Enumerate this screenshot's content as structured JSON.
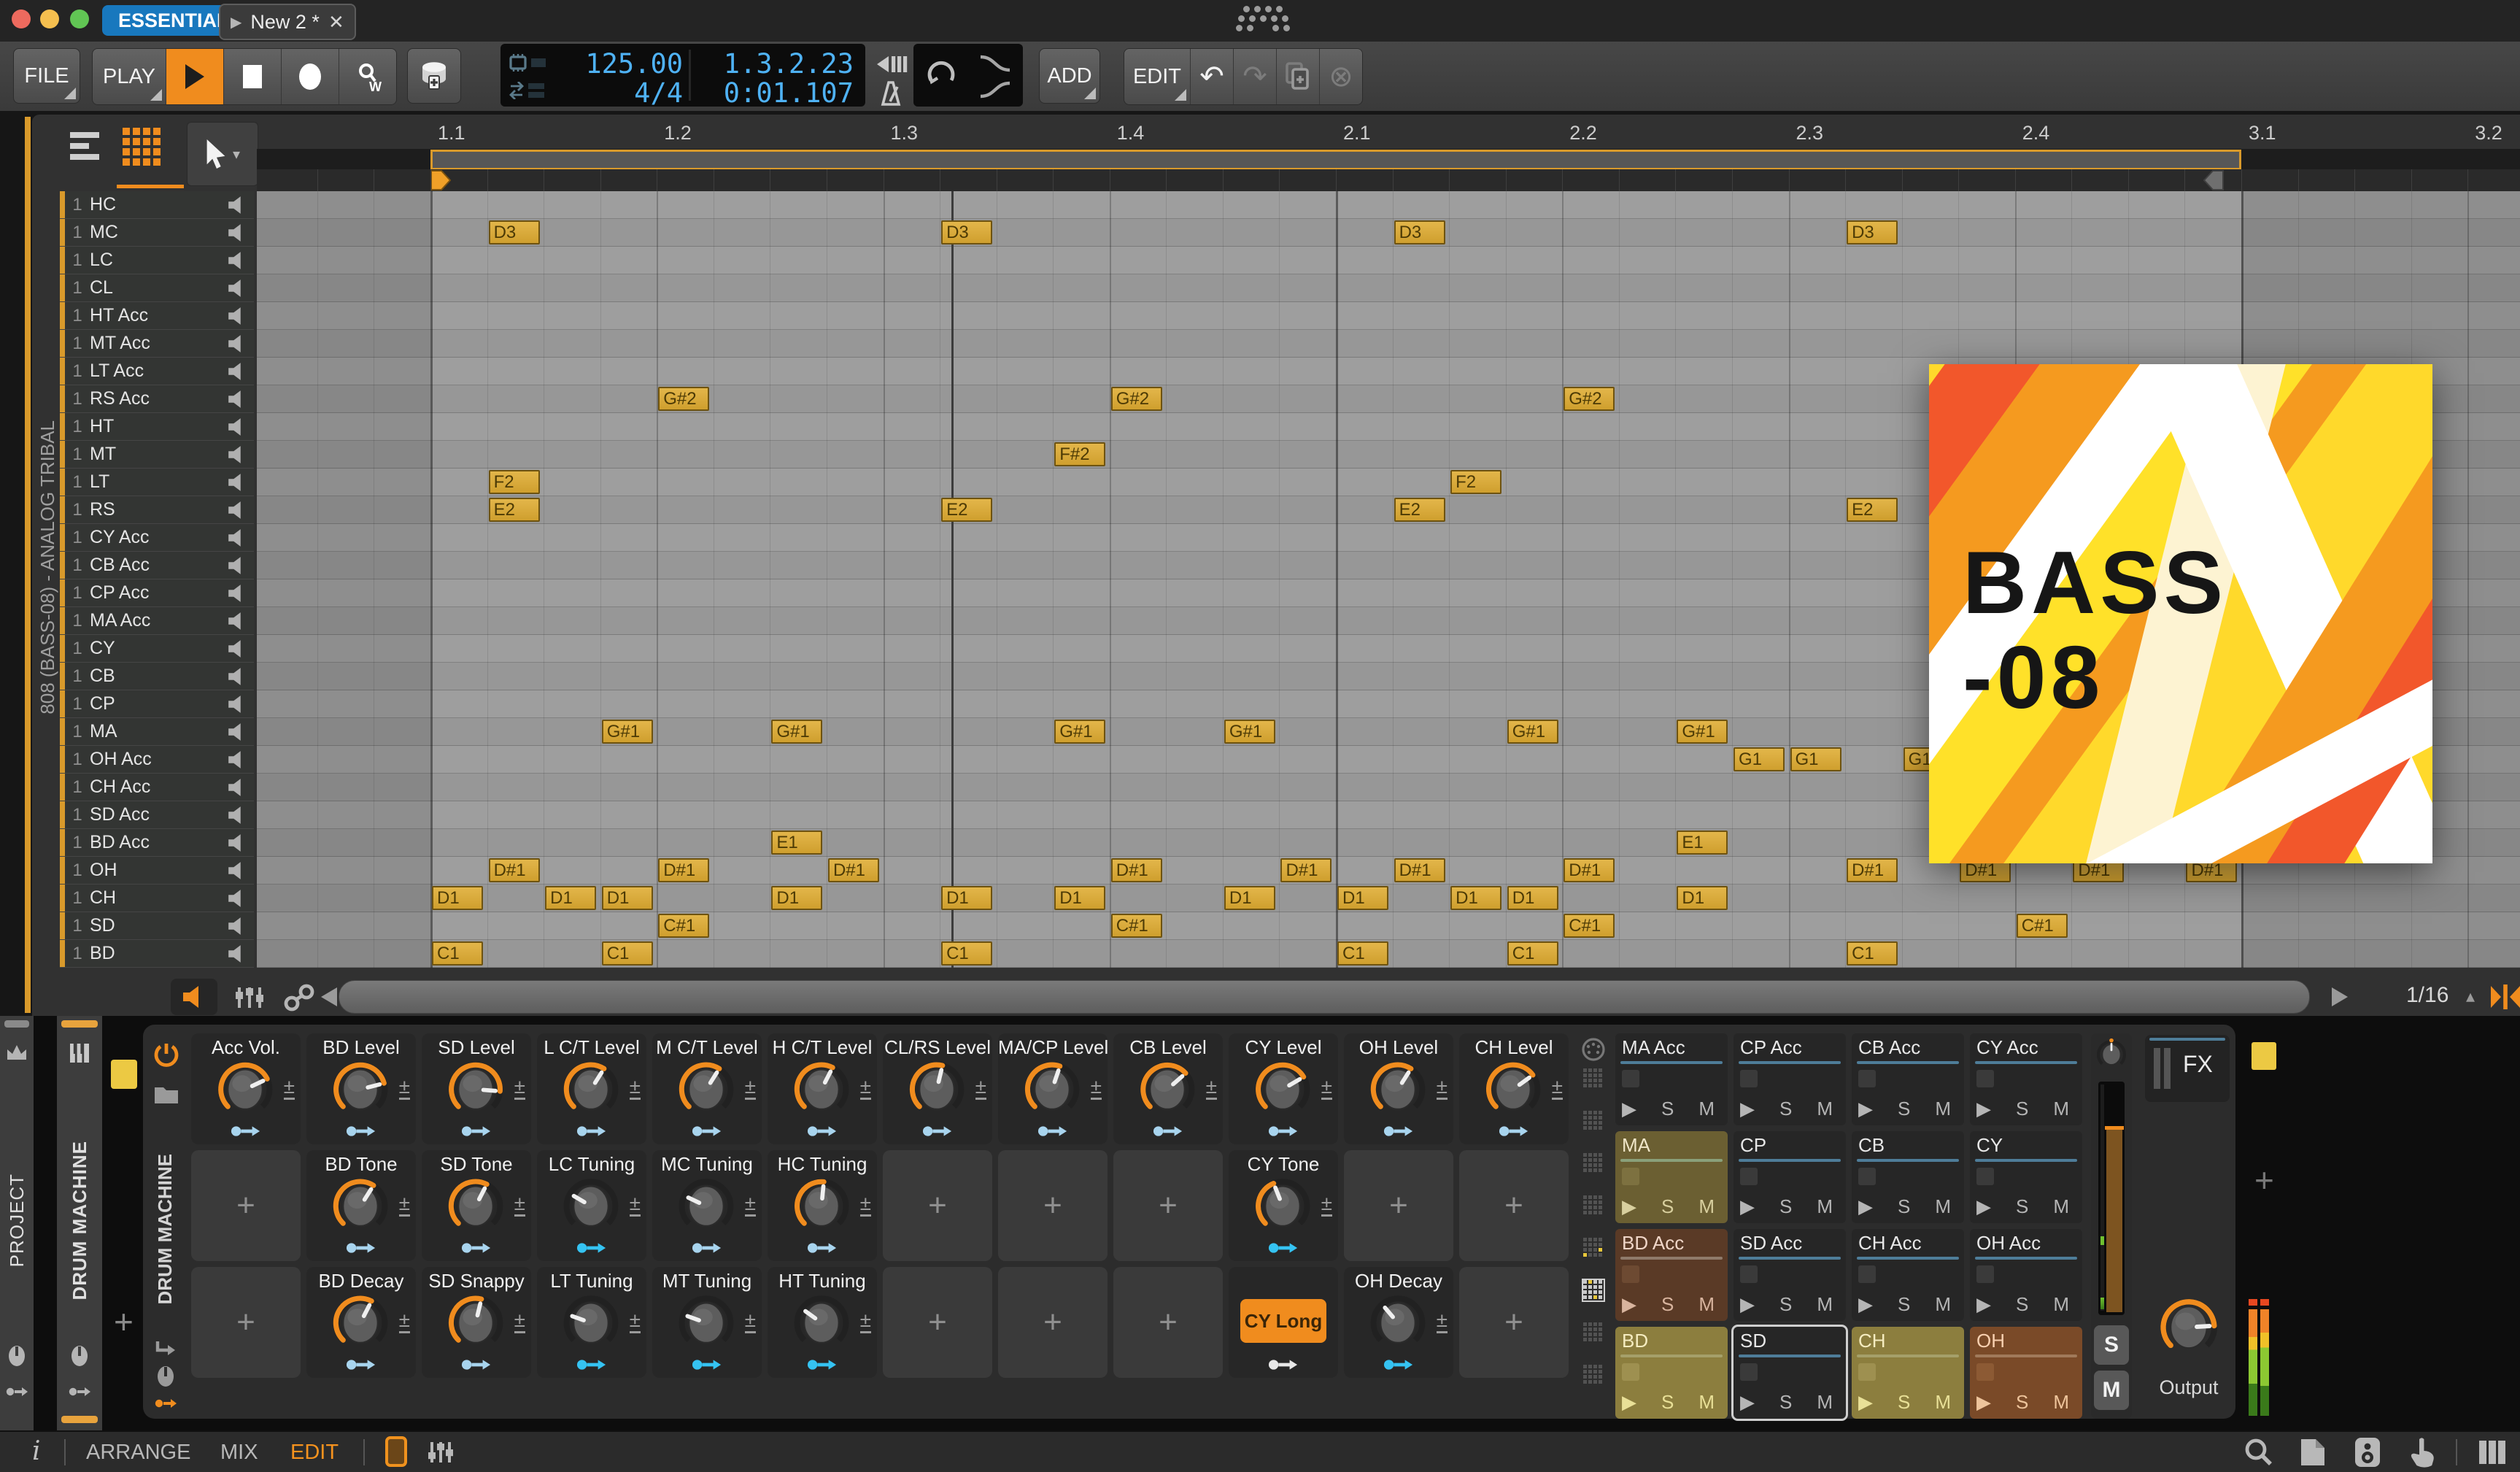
{
  "titlebar": {
    "preset_browser": "ESSENTIALS",
    "tab_play_glyph": "▶",
    "tab": "New 2 *",
    "tab_close": "✕"
  },
  "transport": {
    "file": "FILE",
    "play": "PLAY",
    "tempo": "125.00",
    "time_signature": "4/4",
    "position": "1.3.2.23",
    "time": "0:01.107",
    "add": "ADD",
    "edit": "EDIT",
    "undo_glyph": "↶",
    "redo_glyph": "↷",
    "delete_glyph": "⊗"
  },
  "editor": {
    "track_context": "808 (BASS-08) - ANALOG TRIBAL",
    "ruler_marks": [
      "1.1",
      "1.2",
      "1.3",
      "1.4",
      "2.1",
      "2.2",
      "2.3",
      "2.4",
      "3.1",
      "3.2"
    ],
    "grid_resolution": "1/16",
    "grid_res_stepper": "▴",
    "lanes": [
      {
        "n": "1",
        "name": "HC"
      },
      {
        "n": "1",
        "name": "MC"
      },
      {
        "n": "1",
        "name": "LC"
      },
      {
        "n": "1",
        "name": "CL"
      },
      {
        "n": "1",
        "name": "HT Acc"
      },
      {
        "n": "1",
        "name": "MT Acc"
      },
      {
        "n": "1",
        "name": "LT Acc"
      },
      {
        "n": "1",
        "name": "RS Acc"
      },
      {
        "n": "1",
        "name": "HT"
      },
      {
        "n": "1",
        "name": "MT"
      },
      {
        "n": "1",
        "name": "LT"
      },
      {
        "n": "1",
        "name": "RS"
      },
      {
        "n": "1",
        "name": "CY Acc"
      },
      {
        "n": "1",
        "name": "CB Acc"
      },
      {
        "n": "1",
        "name": "CP Acc"
      },
      {
        "n": "1",
        "name": "MA Acc"
      },
      {
        "n": "1",
        "name": "CY"
      },
      {
        "n": "1",
        "name": "CB"
      },
      {
        "n": "1",
        "name": "CP"
      },
      {
        "n": "1",
        "name": "MA"
      },
      {
        "n": "1",
        "name": "OH Acc"
      },
      {
        "n": "1",
        "name": "CH Acc"
      },
      {
        "n": "1",
        "name": "SD Acc"
      },
      {
        "n": "1",
        "name": "BD Acc"
      },
      {
        "n": "1",
        "name": "OH"
      },
      {
        "n": "1",
        "name": "CH"
      },
      {
        "n": "1",
        "name": "SD"
      },
      {
        "n": "1",
        "name": "BD"
      }
    ],
    "notes": [
      {
        "lane": "MC",
        "label": "D3",
        "steps": [
          1,
          9,
          17,
          25
        ]
      },
      {
        "lane": "RS Acc",
        "label": "G#2",
        "steps": [
          4,
          12,
          20
        ]
      },
      {
        "lane": "MT",
        "label": "F#2",
        "steps": [
          11
        ]
      },
      {
        "lane": "LT",
        "label": "F2",
        "steps": [
          1,
          18
        ]
      },
      {
        "lane": "RS",
        "label": "E2",
        "steps": [
          1,
          9,
          17,
          25
        ]
      },
      {
        "lane": "MA",
        "label": "G#1",
        "steps": [
          3,
          6,
          11,
          14,
          19,
          22
        ]
      },
      {
        "lane": "OH Acc",
        "label": "G1",
        "steps": [
          23,
          24,
          26,
          28,
          30
        ]
      },
      {
        "lane": "BD Acc",
        "label": "E1",
        "steps": [
          6,
          22
        ]
      },
      {
        "lane": "OH",
        "label": "D#1",
        "steps": [
          1,
          4,
          7,
          12,
          15,
          17,
          20,
          25,
          27,
          29,
          31
        ]
      },
      {
        "lane": "CH",
        "label": "D1",
        "steps": [
          0,
          2,
          3,
          6,
          9,
          11,
          14,
          16,
          18,
          19,
          22
        ]
      },
      {
        "lane": "SD",
        "label": "C#1",
        "steps": [
          4,
          12,
          20,
          28
        ]
      },
      {
        "lane": "BD",
        "label": "C1",
        "steps": [
          0,
          3,
          9,
          16,
          19,
          25
        ]
      }
    ]
  },
  "artwork": {
    "title_line1": "BASS",
    "title_line2": "-08"
  },
  "device": {
    "left_tabs": [
      "PROJECT",
      "DRUM MACHINE"
    ],
    "device_name": "DRUM MACHINE",
    "add_cell_glyph": "+",
    "mod_range_glyph": "±",
    "knob_rows": [
      [
        {
          "t": "knob",
          "label": "Acc Vol.",
          "v": 0.74,
          "arc": true,
          "mod": "pale"
        },
        {
          "t": "knob",
          "label": "BD Level",
          "v": 0.78,
          "arc": true,
          "mod": "pale"
        },
        {
          "t": "knob",
          "label": "SD Level",
          "v": 0.85,
          "arc": true,
          "mod": "pale"
        },
        {
          "t": "knob",
          "label": "L C/T Level",
          "v": 0.62,
          "arc": true,
          "mod": "pale"
        },
        {
          "t": "knob",
          "label": "M C/T Level",
          "v": 0.62,
          "arc": true,
          "mod": "pale"
        },
        {
          "t": "knob",
          "label": "H C/T Level",
          "v": 0.6,
          "arc": true,
          "mod": "pale"
        },
        {
          "t": "knob",
          "label": "CL/RS Level",
          "v": 0.55,
          "arc": true,
          "mod": "pale"
        },
        {
          "t": "knob",
          "label": "MA/CP Level",
          "v": 0.57,
          "arc": true,
          "mod": "pale"
        },
        {
          "t": "knob",
          "label": "CB Level",
          "v": 0.68,
          "arc": true,
          "mod": "pale"
        },
        {
          "t": "knob",
          "label": "CY Level",
          "v": 0.72,
          "arc": true,
          "mod": "pale"
        },
        {
          "t": "knob",
          "label": "OH Level",
          "v": 0.62,
          "arc": true,
          "mod": "pale"
        },
        {
          "t": "knob",
          "label": "CH Level",
          "v": 0.7,
          "arc": true,
          "mod": "pale"
        }
      ],
      [
        {
          "t": "add"
        },
        {
          "t": "knob",
          "label": "BD Tone",
          "v": 0.62,
          "arc": true,
          "mod": "pale"
        },
        {
          "t": "knob",
          "label": "SD Tone",
          "v": 0.6,
          "arc": true,
          "mod": "pale"
        },
        {
          "t": "knob",
          "label": "LC Tuning",
          "v": 0.28,
          "arc": false,
          "mod": "cyan"
        },
        {
          "t": "knob",
          "label": "MC Tuning",
          "v": 0.26,
          "arc": false,
          "mod": "pale"
        },
        {
          "t": "knob",
          "label": "HC Tuning",
          "v": 0.52,
          "arc": true,
          "mod": "pale"
        },
        {
          "t": "add"
        },
        {
          "t": "add"
        },
        {
          "t": "add"
        },
        {
          "t": "knob",
          "label": "CY Tone",
          "v": 0.42,
          "arc": true,
          "mod": "cyan"
        },
        {
          "t": "add"
        },
        {
          "t": "add"
        }
      ],
      [
        {
          "t": "add"
        },
        {
          "t": "knob",
          "label": "BD Decay",
          "v": 0.6,
          "arc": true,
          "mod": "pale"
        },
        {
          "t": "knob",
          "label": "SD Snappy",
          "v": 0.55,
          "arc": true,
          "mod": "pale"
        },
        {
          "t": "knob",
          "label": "LT Tuning",
          "v": 0.24,
          "arc": false,
          "mod": "cyan"
        },
        {
          "t": "knob",
          "label": "MT Tuning",
          "v": 0.24,
          "arc": false,
          "mod": "cyan"
        },
        {
          "t": "knob",
          "label": "HT Tuning",
          "v": 0.3,
          "arc": false,
          "mod": "cyan"
        },
        {
          "t": "add"
        },
        {
          "t": "add"
        },
        {
          "t": "add"
        },
        {
          "t": "button",
          "label": "CY Long",
          "mod": "white"
        },
        {
          "t": "knob",
          "label": "OH Decay",
          "v": 0.35,
          "arc": false,
          "mod": "cyan"
        },
        {
          "t": "add"
        }
      ]
    ],
    "pads": [
      {
        "name": "MA Acc",
        "tone": "dark"
      },
      {
        "name": "CP Acc",
        "tone": "dark"
      },
      {
        "name": "CB Acc",
        "tone": "dark"
      },
      {
        "name": "CY Acc",
        "tone": "dark"
      },
      {
        "name": "MA",
        "tone": "olive"
      },
      {
        "name": "CP",
        "tone": "dark"
      },
      {
        "name": "CB",
        "tone": "dark"
      },
      {
        "name": "CY",
        "tone": "dark"
      },
      {
        "name": "BD Acc",
        "tone": "brown"
      },
      {
        "name": "SD Acc",
        "tone": "dark"
      },
      {
        "name": "CH Acc",
        "tone": "dark"
      },
      {
        "name": "OH Acc",
        "tone": "dark"
      },
      {
        "name": "BD",
        "tone": "khaki"
      },
      {
        "name": "SD",
        "tone": "dark",
        "selected": true
      },
      {
        "name": "CH",
        "tone": "khaki"
      },
      {
        "name": "OH",
        "tone": "rust"
      }
    ],
    "pad_play_glyph": "▶",
    "solo": "S",
    "mute": "M",
    "fx": "FX",
    "output": "Output"
  },
  "statusbar": {
    "info_glyph": "i",
    "views": [
      "ARRANGE",
      "MIX",
      "EDIT"
    ],
    "active_view": "EDIT"
  },
  "colors": {
    "accent_orange": "#f08c1e",
    "loop_border": "#d99a2b",
    "note_fill": "#d9a93c",
    "value_blue": "#4fb2f5",
    "essentials_blue": "#1878be",
    "track_color": "#ecc943"
  }
}
